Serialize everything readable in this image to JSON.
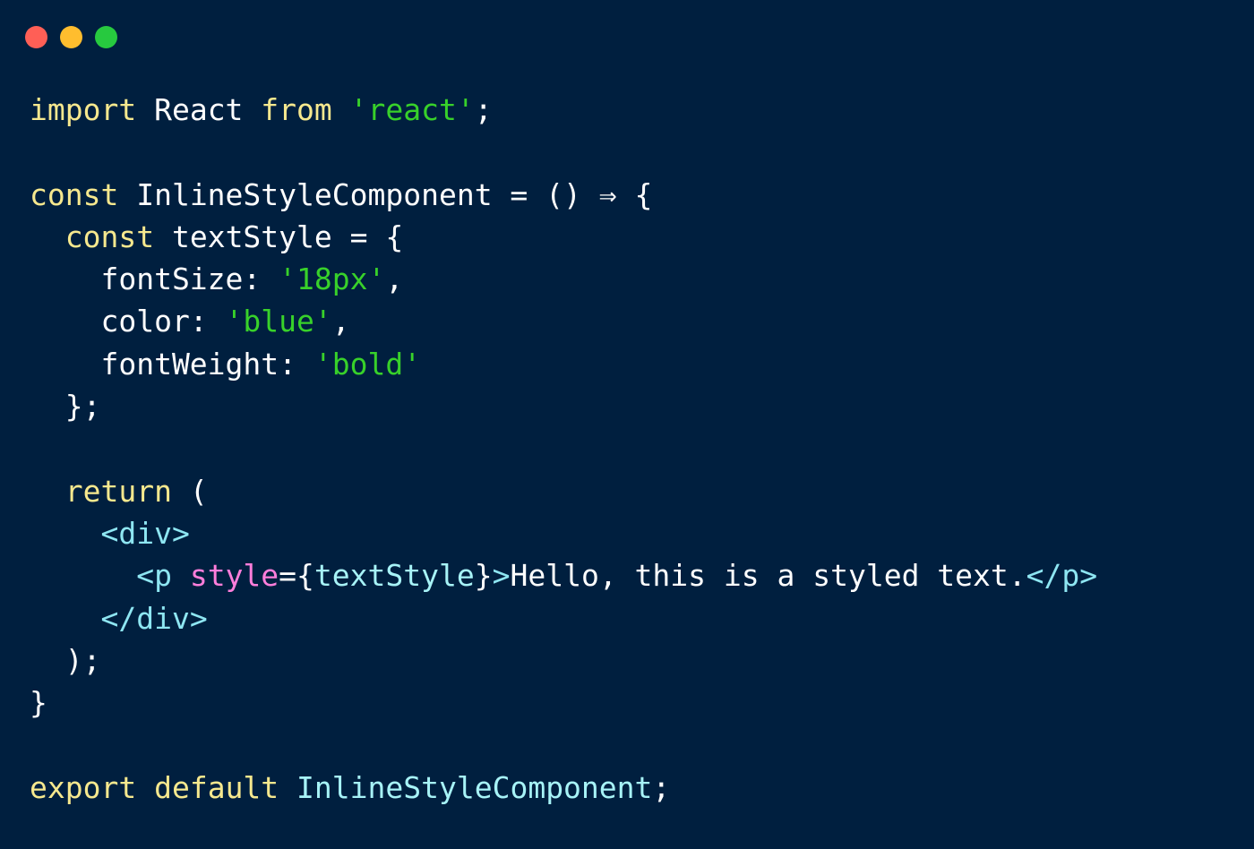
{
  "window": {
    "controls": [
      {
        "name": "close-dot",
        "color": "#ff5f56"
      },
      {
        "name": "minimize-dot",
        "color": "#ffbd2e"
      },
      {
        "name": "maximize-dot",
        "color": "#27c93f"
      }
    ]
  },
  "colors": {
    "background": "#001f3f",
    "keyword": "#f6e88e",
    "string": "#38d12a",
    "plain": "#ffffff",
    "tag": "#8ee6f2",
    "attribute": "#ff7edb",
    "identifier": "#a7f3f7"
  },
  "code_lines": [
    [
      [
        "import",
        "keyword"
      ],
      [
        " React ",
        "plain"
      ],
      [
        "from",
        "keyword"
      ],
      [
        " ",
        "plain"
      ],
      [
        "'react'",
        "string"
      ],
      [
        ";",
        "plain"
      ]
    ],
    [],
    [
      [
        "const",
        "keyword"
      ],
      [
        " InlineStyleComponent = () ⇒ {",
        "plain"
      ]
    ],
    [
      [
        "  ",
        "plain"
      ],
      [
        "const",
        "keyword"
      ],
      [
        " textStyle = {",
        "plain"
      ]
    ],
    [
      [
        "    fontSize: ",
        "plain"
      ],
      [
        "'18px'",
        "string"
      ],
      [
        ",",
        "plain"
      ]
    ],
    [
      [
        "    color: ",
        "plain"
      ],
      [
        "'blue'",
        "string"
      ],
      [
        ",",
        "plain"
      ]
    ],
    [
      [
        "    fontWeight: ",
        "plain"
      ],
      [
        "'bold'",
        "string"
      ]
    ],
    [
      [
        "  };",
        "plain"
      ]
    ],
    [],
    [
      [
        "  ",
        "plain"
      ],
      [
        "return",
        "keyword"
      ],
      [
        " (",
        "plain"
      ]
    ],
    [
      [
        "    ",
        "plain"
      ],
      [
        "<div>",
        "tag"
      ]
    ],
    [
      [
        "      ",
        "plain"
      ],
      [
        "<p ",
        "tag"
      ],
      [
        "style",
        "attribute"
      ],
      [
        "={",
        "plain"
      ],
      [
        "textStyle",
        "identifier"
      ],
      [
        "}",
        "plain"
      ],
      [
        ">",
        "tag"
      ],
      [
        "Hello, this is a styled text.",
        "plain"
      ],
      [
        "</p>",
        "tag"
      ]
    ],
    [
      [
        "    ",
        "plain"
      ],
      [
        "</div>",
        "tag"
      ]
    ],
    [
      [
        "  );",
        "plain"
      ]
    ],
    [
      [
        "}",
        "plain"
      ]
    ],
    [],
    [
      [
        "export",
        "keyword"
      ],
      [
        " ",
        "plain"
      ],
      [
        "default",
        "keyword"
      ],
      [
        " ",
        "plain"
      ],
      [
        "InlineStyleComponent",
        "identifier"
      ],
      [
        ";",
        "plain"
      ]
    ]
  ]
}
